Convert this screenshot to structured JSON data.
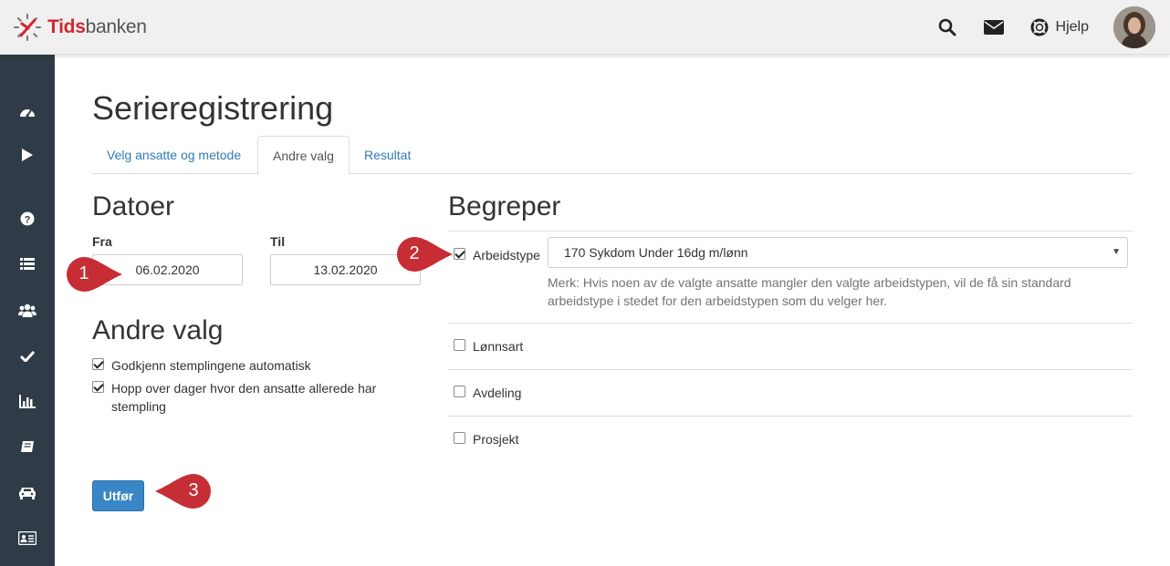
{
  "header": {
    "logo": {
      "part1": "Tids",
      "part2": "banken"
    },
    "help_label": "Hjelp",
    "icons": [
      "search-icon",
      "mail-icon",
      "lifebuoy-icon"
    ],
    "avatar": "user-avatar"
  },
  "sidebar": {
    "items": [
      {
        "icon": "dashboard-icon"
      },
      {
        "icon": "play-icon"
      },
      {
        "icon": "question-icon"
      },
      {
        "icon": "list-icon"
      },
      {
        "icon": "users-icon"
      },
      {
        "icon": "check-icon"
      },
      {
        "icon": "bar-chart-icon"
      },
      {
        "icon": "book-icon"
      },
      {
        "icon": "car-icon"
      },
      {
        "icon": "id-card-icon"
      }
    ]
  },
  "page": {
    "title": "Serieregistrering",
    "tabs": [
      {
        "label": "Velg ansatte og metode",
        "active": false
      },
      {
        "label": "Andre valg",
        "active": true
      },
      {
        "label": "Resultat",
        "active": false
      }
    ]
  },
  "dates": {
    "title": "Datoer",
    "from_label": "Fra",
    "from_value": "06.02.2020",
    "to_label": "Til",
    "to_value": "13.02.2020"
  },
  "other": {
    "title": "Andre valg",
    "options": [
      {
        "label": "Godkjenn stemplingene automatisk",
        "checked": true
      },
      {
        "label": "Hopp over dager hvor den ansatte allerede har stempling",
        "checked": true
      }
    ]
  },
  "action": {
    "button_label": "Utfør"
  },
  "terms": {
    "title": "Begreper",
    "arbeidstype": {
      "label": "Arbeidstype",
      "checked": true,
      "selected": "170 Sykdom Under 16dg m/lønn",
      "note": "Merk: Hvis noen av de valgte ansatte mangler den valgte arbeidstypen, vil de få sin standard arbeidstype i stedet for den arbeidstypen som du velger her."
    },
    "items": [
      {
        "label": "Lønnsart",
        "checked": false
      },
      {
        "label": "Avdeling",
        "checked": false
      },
      {
        "label": "Prosjekt",
        "checked": false
      }
    ]
  },
  "callouts": [
    "1",
    "2",
    "3"
  ],
  "colors": {
    "accent": "#3a87c8",
    "sidebar": "#2f3b46",
    "callout": "#c62d35",
    "logo_red": "#d22630"
  }
}
